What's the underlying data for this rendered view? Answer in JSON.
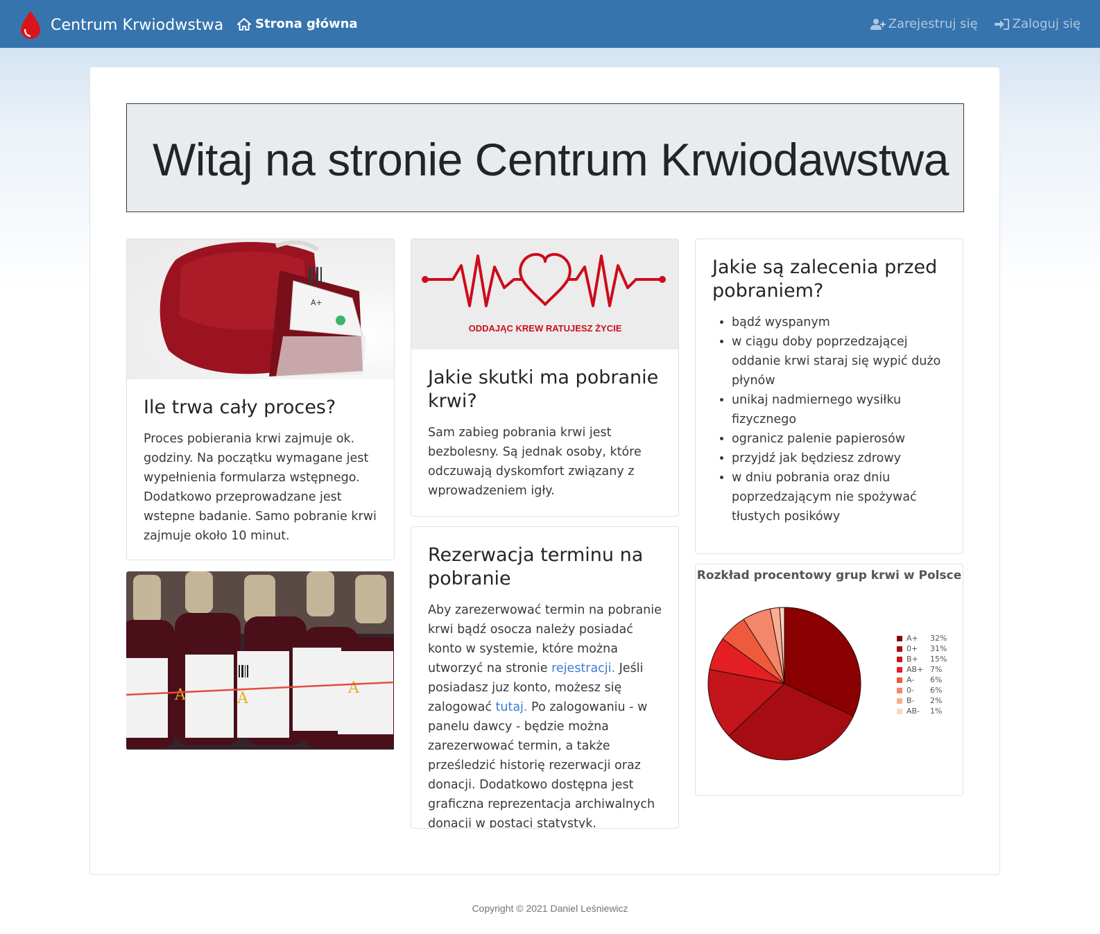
{
  "navbar": {
    "brand": "Centrum Krwiodwstwa",
    "home": "Strona główna",
    "register": "Zarejestruj się",
    "login": "Zaloguj się"
  },
  "jumbotron": {
    "title": "Witaj na stronie Centrum Krwiodawstwa"
  },
  "card_process": {
    "title": "Ile trwa cały proces?",
    "text": "Proces pobierania krwi zajmuje ok. godziny. Na początku wymagane jest wypełnienia formularza wstępnego. Dodatkowo przeprowadzane jest wstepne badanie. Samo pobranie krwi zajmuje około 10 minut."
  },
  "card_effects": {
    "banner_text": "ODDAJĄC KREW RATUJESZ ŻYCIE",
    "title": "Jakie skutki ma pobranie krwi?",
    "text": "Sam zabieg pobrania krwi jest bezbolesny. Są jednak osoby, które odczuwają dyskomfort związany z wprowadzeniem igły."
  },
  "card_reservation": {
    "title": "Rezerwacja terminu na pobranie",
    "text_1": "Aby zarezerwować termin na pobranie krwi bądź osocza należy posiadać konto w systemie, które można utworzyć na stronie ",
    "link_register": "rejestracji.",
    "text_2": " Jeśli posiadasz juz konto, możesz się zalogować ",
    "link_login": "tutaj.",
    "text_3": " Po zalogowaniu - w panelu dawcy - będzie można zarezerwować termin, a także prześledzić historię rezerwacji oraz donacji. Dodatkowo dostępna jest graficzna reprezentacja archiwalnych donacji w postaci statystyk."
  },
  "card_recommendations": {
    "title": "Jakie są zalecenia przed pobraniem?",
    "items": [
      "bądź wyspanym",
      "w ciągu doby poprzedzającej oddanie krwi staraj się wypić dużo płynów",
      "unikaj nadmiernego wysiłku fizycznego",
      "ogranicz palenie papierosów",
      "przyjdź jak będziesz zdrowy",
      "w dniu pobrania oraz dniu poprzedzającym nie spożywać tłustych posikówy"
    ]
  },
  "chart_data": {
    "type": "pie",
    "title": "Rozkład procentowy grup krwi w Polsce",
    "categories": [
      "A+",
      "0+",
      "B+",
      "AB+",
      "A-",
      "0-",
      "B-",
      "AB-"
    ],
    "values": [
      32,
      31,
      15,
      7,
      6,
      6,
      2,
      1
    ],
    "value_labels": [
      "32%",
      "31%",
      "15%",
      "7%",
      "6%",
      "6%",
      "2%",
      "1%"
    ],
    "colors": [
      "#8b0000",
      "#a50d12",
      "#c4151b",
      "#e41f23",
      "#ef5a3c",
      "#f4866a",
      "#f8ae93",
      "#fcd6c4"
    ],
    "legend_position": "right"
  },
  "footer": {
    "copyright": "Copyright © 2021 Daniel Leśniewicz"
  }
}
